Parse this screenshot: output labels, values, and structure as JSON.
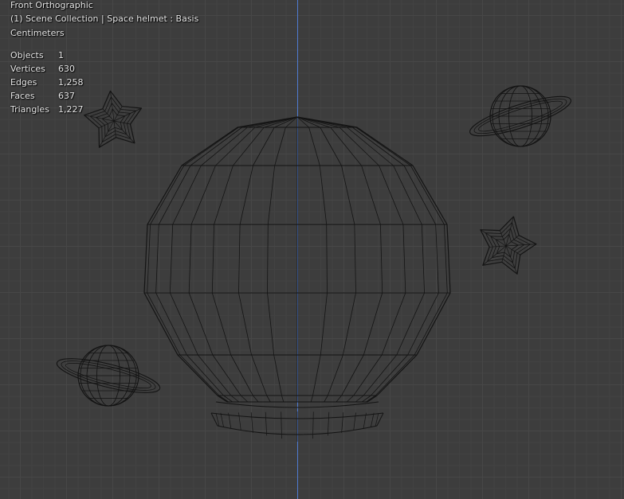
{
  "viewport": {
    "view_name": "Front Orthographic",
    "collection_info": "(1) Scene Collection | Space helmet : Basis",
    "units": "Centimeters",
    "colors": {
      "background": "#3d3d3d",
      "grid": "#474747",
      "axis_z": "#4f7bd2",
      "wireframe": "#141414"
    }
  },
  "stats": [
    {
      "label": "Objects",
      "value": "1"
    },
    {
      "label": "Vertices",
      "value": "630"
    },
    {
      "label": "Edges",
      "value": "1,258"
    },
    {
      "label": "Faces",
      "value": "637"
    },
    {
      "label": "Triangles",
      "value": "1,227"
    }
  ],
  "scene_objects": [
    {
      "name": "helmet",
      "icon": "wireframe-mesh"
    },
    {
      "name": "star",
      "icon": "wireframe-mesh"
    },
    {
      "name": "star",
      "icon": "wireframe-mesh"
    },
    {
      "name": "planet",
      "icon": "wireframe-mesh"
    },
    {
      "name": "planet",
      "icon": "wireframe-mesh"
    }
  ]
}
